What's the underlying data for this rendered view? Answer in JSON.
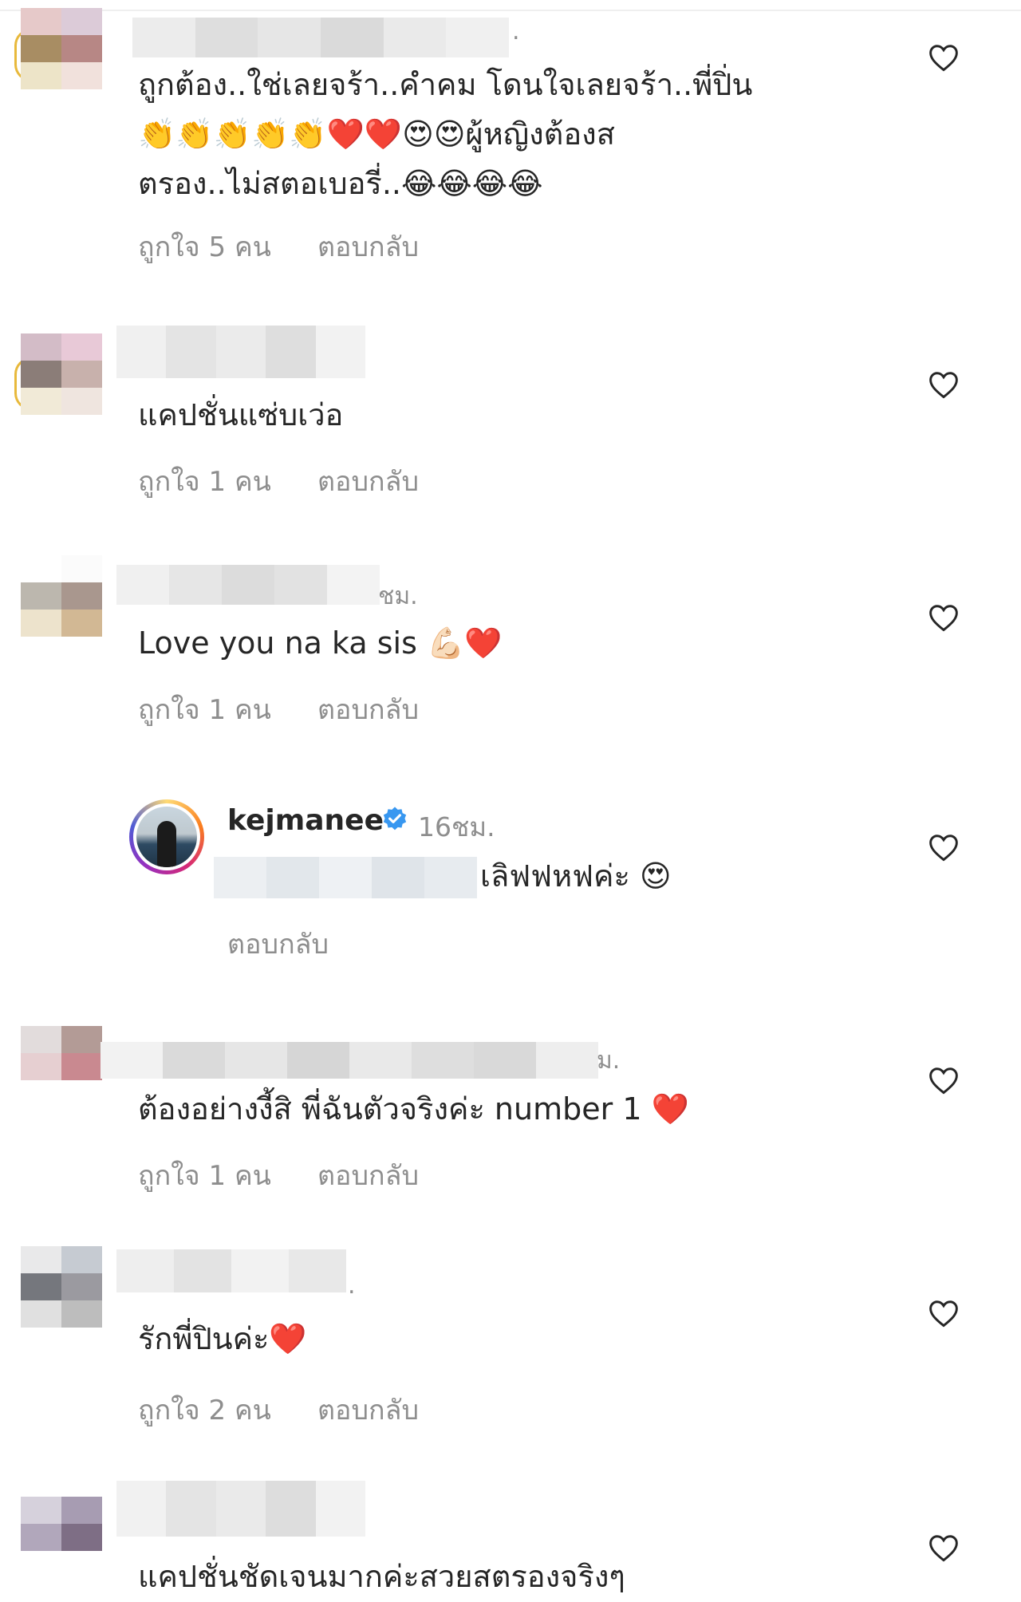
{
  "comments": [
    {
      "suffix": ".",
      "text_lines": [
        "ถูกต้อง..ใช่เลยจร้า..คำคม โดนใจเลยจร้า..พี่ปิ่น",
        "👏👏👏👏👏❤️❤️😍😍ผู้หญิงต้องส",
        "ตรอง..ไม่สตอเบอรี่..😂😂😂😂"
      ],
      "likes": "ถูกใจ 5 คน",
      "reply": "ตอบกลับ"
    },
    {
      "suffix": "",
      "text_lines": [
        "แคปชั่นแซ่บเว่อ"
      ],
      "likes": "ถูกใจ 1 คน",
      "reply": "ตอบกลับ"
    },
    {
      "suffix": "ชม.",
      "text_lines": [
        "Love you na ka sis 💪🏻❤️"
      ],
      "likes": "ถูกใจ 1 คน",
      "reply": "ตอบกลับ"
    },
    {
      "suffix": "ม.",
      "text_lines": [
        "ต้องอย่างงี้สิ พี่ฉันตัวจริงค่ะ number 1 ❤️"
      ],
      "likes": "ถูกใจ 1 คน",
      "reply": "ตอบกลับ"
    },
    {
      "suffix": ".",
      "text_lines": [
        "รักพี่ปินค่ะ❤️"
      ],
      "likes": "ถูกใจ 2 คน",
      "reply": "ตอบกลับ"
    },
    {
      "suffix": "",
      "text_lines": [
        "แคปชั่นชัดเจนมากค่ะสวยสตรองจริงๆ"
      ],
      "likes": "",
      "reply": ""
    }
  ],
  "owner_reply": {
    "username": "kejmanee",
    "time": "16ชม.",
    "text": "เลิฟฟหฟค่ะ 😍",
    "reply": "ตอบกลับ"
  },
  "colors": {
    "text": "#262626",
    "secondary": "#8e8e8e",
    "verified": "#3897f0"
  },
  "icons": {
    "like": "heart-outline-icon",
    "verified": "verified-badge-icon"
  }
}
